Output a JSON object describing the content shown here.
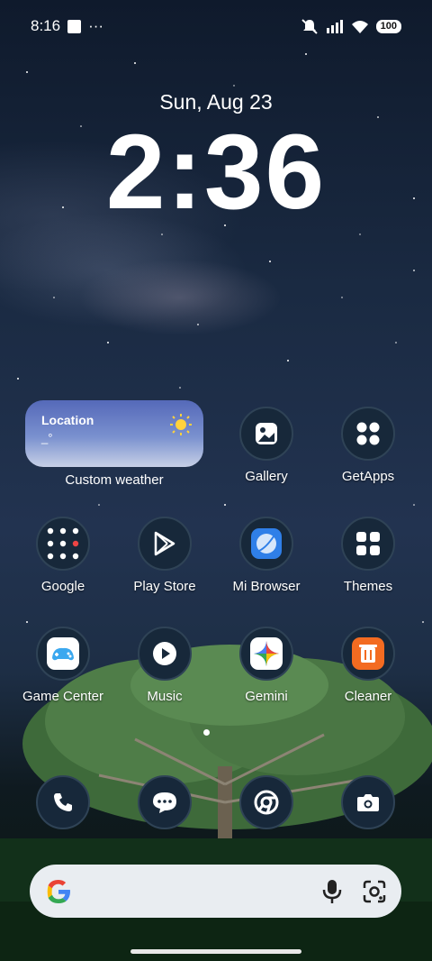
{
  "status_bar": {
    "time": "8:16",
    "more": "···",
    "battery": "100"
  },
  "lock": {
    "date": "Sun, Aug 23",
    "time": "2:36"
  },
  "widget": {
    "location": "Location",
    "temp": "_°",
    "label": "Custom weather"
  },
  "apps": {
    "gallery": "Gallery",
    "getapps": "GetApps",
    "google": "Google",
    "play_store": "Play Store",
    "mi_browser": "Mi Browser",
    "themes": "Themes",
    "game_center": "Game Center",
    "music": "Music",
    "gemini": "Gemini",
    "cleaner": "Cleaner"
  },
  "icons": {
    "dock": [
      "phone-icon",
      "messages-icon",
      "chrome-icon",
      "camera-icon"
    ],
    "search_bar": [
      "google-g-icon",
      "mic-icon",
      "lens-icon"
    ]
  },
  "colors": {
    "widget_top": "#5569b9",
    "icon_bg": "#17283a",
    "search_bg": "#e9edf1"
  }
}
